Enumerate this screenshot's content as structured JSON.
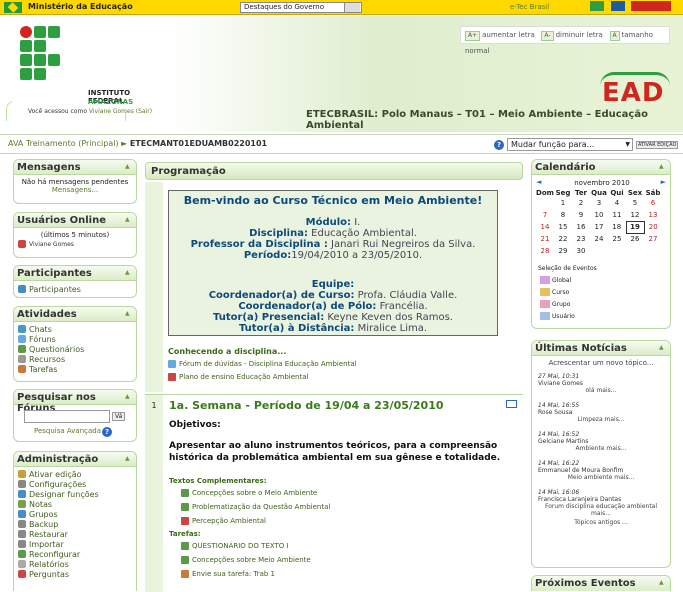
{
  "gov": {
    "ministry": "Ministério da Educação",
    "select": "Destaques do Governo",
    "tel": "e-Tec Brasil"
  },
  "header": {
    "if_name": "INSTITUTO FEDERAL",
    "if_state": "AMAZONAS",
    "logged_prefix": "Você acessou como",
    "logged_user": "Viviane Gomes (Sair)",
    "font_larger": "aumentar letra",
    "font_smaller": "diminuir letra",
    "font_normal": "tamanho normal",
    "ead": "EAD",
    "course_title": "ETECBRASIL: Polo Manaus – T01 – Meio Ambiente – Educação Ambiental"
  },
  "nav": {
    "home": "AVA Treinamento (Principal)",
    "sep": "►",
    "course": "ETECMANT01EDUAMB0220101",
    "role": "Mudar função para...",
    "edit": "ATIVAR EDIÇÃO"
  },
  "blocks": {
    "mensagens": {
      "title": "Mensagens",
      "text": "Não há mensagens pendentes",
      "link": "Mensagens..."
    },
    "online": {
      "title": "Usuários Online",
      "period": "(últimos 5 minutos)",
      "user": "Viviane Gomes"
    },
    "participantes": {
      "title": "Participantes",
      "item": "Participantes"
    },
    "atividades": {
      "title": "Atividades",
      "items": [
        "Chats",
        "Fóruns",
        "Questionários",
        "Recursos",
        "Tarefas"
      ]
    },
    "foruns": {
      "title": "Pesquisar nos Fóruns",
      "go": "Vá",
      "adv": "Pesquisa Avançada"
    },
    "admin": {
      "title": "Administração",
      "items": [
        "Ativar edição",
        "Configurações",
        "Designar funções",
        "Notas",
        "Grupos",
        "Backup",
        "Restaurar",
        "Importar",
        "Reconfigurar",
        "Relatórios",
        "Perguntas"
      ]
    }
  },
  "center": {
    "heading": "Programação",
    "welcome": {
      "title": "Bem-vindo ao Curso Técnico em Meio Ambiente!",
      "modulo_l": "Módulo:",
      "modulo_v": " I.",
      "disc_l": "Disciplina:",
      "disc_v": " Educação Ambiental.",
      "prof_l": "Professor da Disciplina :",
      "prof_v": " Janari Rui Negreiros da Silva.",
      "per_l": "Período:",
      "per_v": "19/04/2010 a 23/05/2010.",
      "equipe": "Equipe:",
      "coord_l": "Coordenador(a) de Curso:",
      "coord_v": " Profa. Cláudia Valle.",
      "polo_l": "Coordenador(a) de Pólo:",
      "polo_v": " Francélia.",
      "tp_l": "Tutor(a) Presencial:",
      "tp_v": " Keyne Keven dos Ramos.",
      "td_l": "Tutor(a) à Distância:",
      "td_v": " Miralice Lima."
    },
    "conhecendo": "Conhecendo a disciplina...",
    "forum": "Fórum de dúvidas - Disciplina Educação Ambiental",
    "plano": "Plano de ensino Educação Ambiental",
    "week_num": "1",
    "week_title": "1a. Semana - Período de 19/04 a 23/05/2010",
    "objetivos": "Objetivos:",
    "obj_text1": "Apresentar ao aluno instrumentos teóricos, para a compreensão",
    "obj_text2": "histórica da problemática ambiental em sua gênese e totalidade.",
    "textos": "Textos Complementares:",
    "t1": "Concepções sobre o Meio Ambiente",
    "t2": "Problematização da Questão Ambiental",
    "t3": "Percepção Ambiental",
    "tarefas": "Tarefas:",
    "k1": "QUESTIONÁRIO DO TEXTO I",
    "k2": "Concepções sobre Meio Ambiente",
    "k3": "Envie sua tarefa: Trab 1"
  },
  "calendar": {
    "title": "Calendário",
    "month": "novembro 2010",
    "days": [
      "Dom",
      "Seg",
      "Ter",
      "Qua",
      "Qui",
      "Sex",
      "Sáb"
    ],
    "weeks": [
      [
        "",
        "1",
        "2",
        "3",
        "4",
        "5",
        "6"
      ],
      [
        "7",
        "8",
        "9",
        "10",
        "11",
        "12",
        "13"
      ],
      [
        "14",
        "15",
        "16",
        "17",
        "18",
        "19",
        "20"
      ],
      [
        "21",
        "22",
        "23",
        "24",
        "25",
        "26",
        "27"
      ],
      [
        "28",
        "29",
        "30",
        "",
        "",
        "",
        ""
      ]
    ],
    "events_title": "Seleção de Eventos",
    "ev": [
      "Global",
      "Curso",
      "Grupo",
      "Usuário"
    ]
  },
  "news": {
    "title": "Últimas Notícias",
    "add": "Acrescentar um novo tópico...",
    "items": [
      {
        "date": "27 Mai, 10:31",
        "name": "Viviane Gomes",
        "more": "olá mais..."
      },
      {
        "date": "14 Mai, 16:55",
        "name": "Rose Sousa",
        "more": "Limpeza mais..."
      },
      {
        "date": "14 Mai, 16:52",
        "name": "Gelciane Martins",
        "more": "Ambiente mais..."
      },
      {
        "date": "14 Mai, 16:22",
        "name": "Emmanuel de Moura Bonfim",
        "more": "Meio ambiente mais..."
      },
      {
        "date": "14 Mai, 16:06",
        "name": "Francisca Laranjeira Dantas",
        "more": "Forum disciplina educação ambiental mais..."
      }
    ],
    "older": "Tópicos antigos ..."
  },
  "proximos": {
    "title": "Próximos Eventos"
  }
}
